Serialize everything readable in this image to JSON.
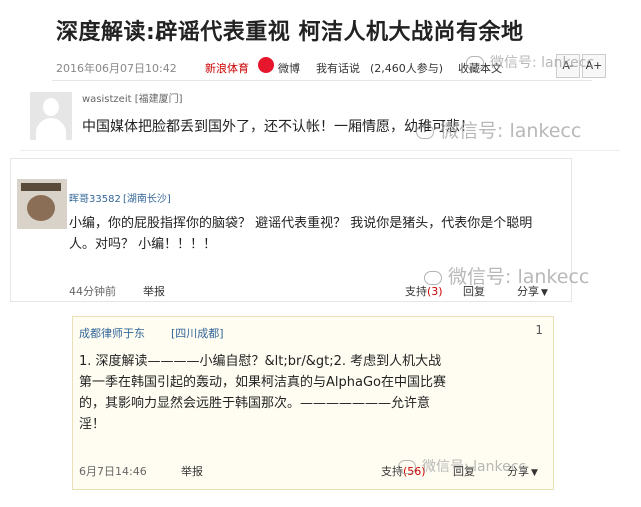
{
  "article": {
    "title": "深度解读:辟谣代表重视 柯洁人机大战尚有余地",
    "date": "2016年06月07日10:42",
    "source": "新浪体育",
    "weibo_label": "微博",
    "said_label": "我有话说",
    "comment_count": "(2,460人参与)",
    "favorite_label": "收藏本文",
    "font_smaller": "A-",
    "font_larger": "A+"
  },
  "comments": [
    {
      "user": "wasistzeit",
      "location": "[福建厦门]",
      "text": "中国媒体把脸都丢到国外了，还不认帐！一厢情愿，幼稚可悲！"
    },
    {
      "user": "晖哥33582",
      "location": "[湖南长沙]",
      "text": "小编，你的屁股指挥你的脑袋？ 避谣代表重视？ 我说你是猪头，代表你是个聪明人。对吗？ 小编！！！！",
      "time": "44分钟前",
      "report": "举报",
      "support": "支持",
      "support_count": "(3)",
      "reply": "回复",
      "share": "分享"
    },
    {
      "user": "成都律师于东",
      "location": "[四川成都]",
      "floor": "1",
      "text": "1. 深度解读————小编自慰？&lt;br/&gt;2. 考虑到人机大战第一季在韩国引起的轰动，如果柯洁真的与AlphaGo在中国比赛的，其影响力显然会远胜于韩国那次。———————允许意淫！",
      "time": "6月7日14:46",
      "report": "举报",
      "support": "支持",
      "support_count": "(56)",
      "reply": "回复",
      "share": "分享"
    }
  ],
  "watermark": "微信号: lankecc",
  "colors": {
    "source": "#cc0000",
    "username": "#336699",
    "floor_bg": "#fffdf2"
  }
}
